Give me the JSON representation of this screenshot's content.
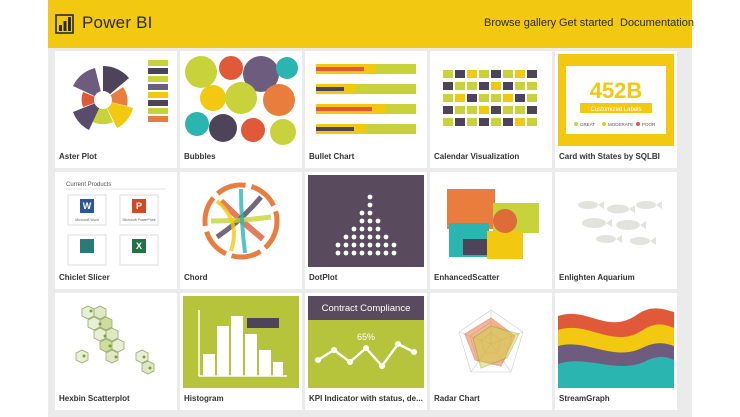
{
  "header": {
    "brand": "Power BI",
    "logo_icon": "power-bi-logo-icon",
    "nav": [
      "Browse gallery",
      "Get started",
      "Documentation"
    ],
    "background": "#F2C811"
  },
  "gallery": {
    "cards": [
      {
        "title": "Aster Plot"
      },
      {
        "title": "Bubbles"
      },
      {
        "title": "Bullet Chart"
      },
      {
        "title": "Calendar Visualization"
      },
      {
        "title": "Card with States by SQLBI"
      },
      {
        "title": "Chiclet Slicer"
      },
      {
        "title": "Chord"
      },
      {
        "title": "DotPlot"
      },
      {
        "title": "EnhancedScatter"
      },
      {
        "title": "Enlighten Aquarium"
      },
      {
        "title": "Hexbin Scatterplot"
      },
      {
        "title": "Histogram"
      },
      {
        "title": "KPI Indicator with status, de..."
      },
      {
        "title": "Radar Chart"
      },
      {
        "title": "StreamGraph"
      }
    ]
  },
  "thumbnails": {
    "card_with_states": {
      "value": "452B",
      "subtitle": "Customized Labels",
      "legend": [
        "GREAT",
        "MODERATE",
        "POOR"
      ]
    },
    "chiclet_slicer": {
      "heading": "Current Products",
      "items": [
        "Microsoft Word",
        "Microsoft PowerPoint",
        "",
        ""
      ]
    },
    "kpi_indicator": {
      "title": "Contract Compliance",
      "value": "65%"
    }
  }
}
